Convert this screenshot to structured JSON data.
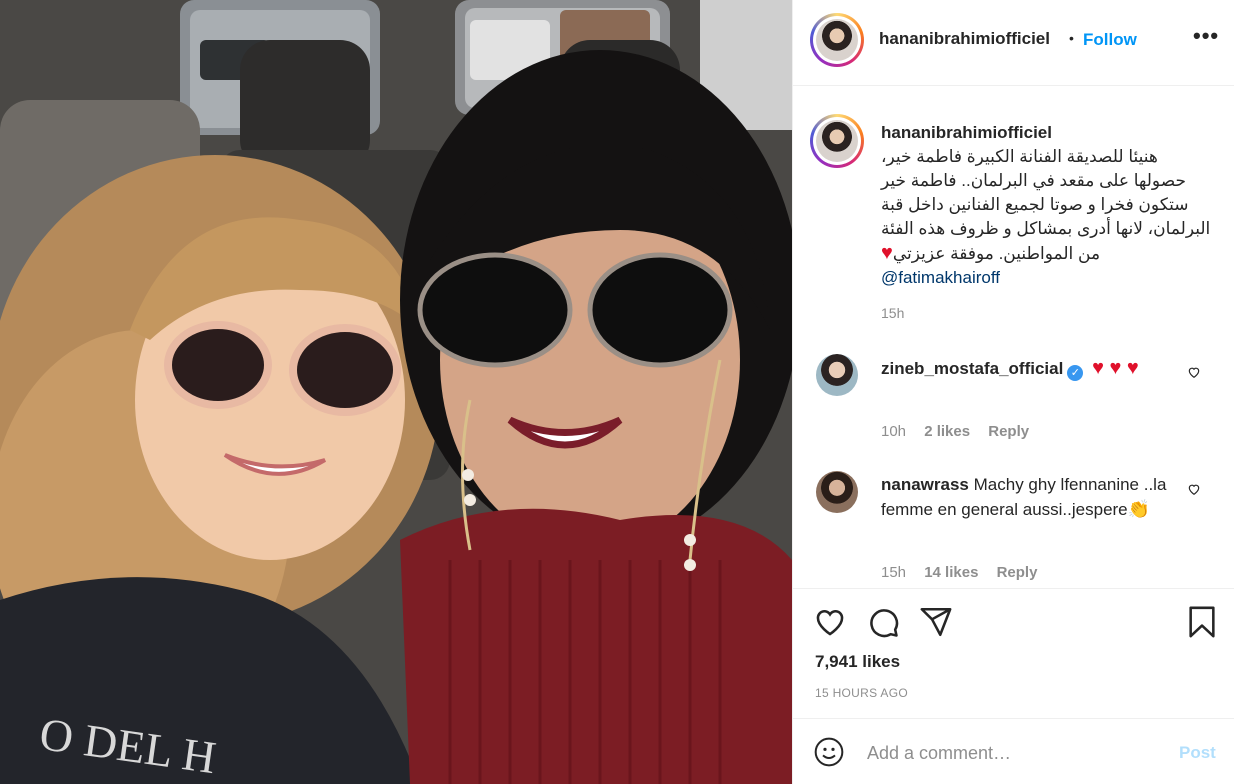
{
  "post": {
    "username": "hananibrahimiofficiel",
    "follow_label": "Follow",
    "dot": "•",
    "more_label": "•••"
  },
  "caption": {
    "username": "hananibrahimiofficiel",
    "text": "هنيئا للصديقة الفنانة الكبيرة فاطمة خير، حصولها على مقعد في البرلمان.. فاطمة خير ستكون فخرا و صوتا لجميع الفنانين داخل قبة البرلمان، لانها أدرى بمشاكل و ظروف هذه الفئة من المواطنين. موفقة عزيزتي",
    "heart": "♥",
    "mention": "@fatimakhairoff",
    "time": "15h"
  },
  "comments": [
    {
      "username": "zineb_mostafa_official",
      "verified_mark": "✓",
      "text": "♥ ♥ ♥",
      "time": "10h",
      "likes": "2 likes",
      "reply": "Reply"
    },
    {
      "username": "nanawrass",
      "text": "Machy ghy lfennanine ..la femme en general aussi..jespere",
      "emoji": "👏",
      "time": "15h",
      "likes": "14 likes",
      "reply": "Reply"
    }
  ],
  "stats": {
    "likes": "7,941 likes",
    "posted": "15 HOURS AGO"
  },
  "compose": {
    "placeholder": "Add a comment…",
    "post_label": "Post"
  },
  "colors": {
    "link": "#0095f6",
    "mention": "#00376b",
    "heart": "#e0112b",
    "muted": "#8e8e8e"
  }
}
